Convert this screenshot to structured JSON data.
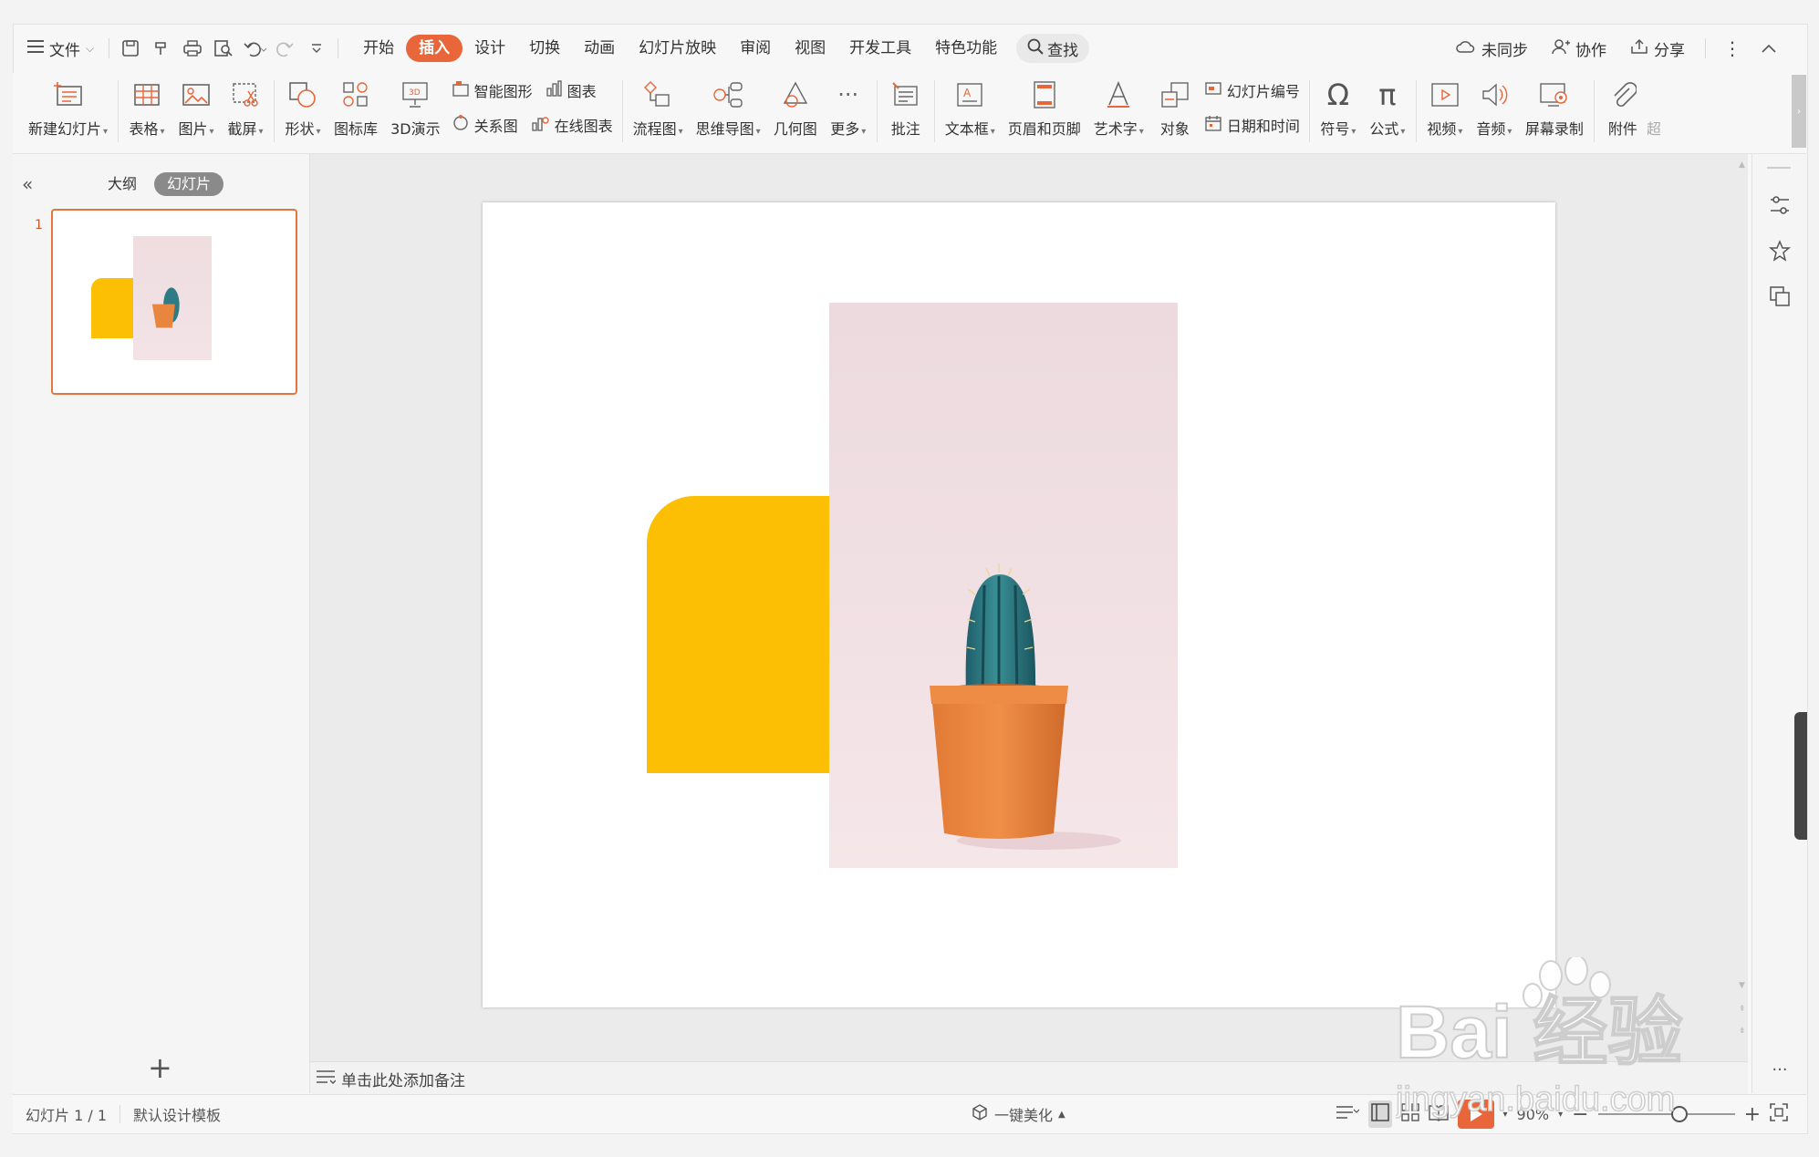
{
  "menubar": {
    "file_label": "文件",
    "tabs": [
      "开始",
      "插入",
      "设计",
      "切换",
      "动画",
      "幻灯片放映",
      "审阅",
      "视图",
      "开发工具",
      "特色功能"
    ],
    "active_tab": "插入",
    "search_label": "查找",
    "sync_label": "未同步",
    "collab_label": "协作",
    "share_label": "分享"
  },
  "ribbon": {
    "new_slide": "新建幻灯片",
    "table": "表格",
    "picture": "图片",
    "screenshot": "截屏",
    "shape": "形状",
    "icon_lib": "图标库",
    "demo3d": "3D演示",
    "smart_art": "智能图形",
    "chart": "图表",
    "relation": "关系图",
    "online_chart": "在线图表",
    "flowchart": "流程图",
    "mindmap": "思维导图",
    "geometry": "几何图",
    "more": "更多",
    "comment": "批注",
    "textbox": "文本框",
    "header_footer": "页眉和页脚",
    "wordart": "艺术字",
    "object": "对象",
    "slide_number": "幻灯片编号",
    "datetime": "日期和时间",
    "symbol": "符号",
    "formula": "公式",
    "video": "视频",
    "audio": "音频",
    "screen_record": "屏幕录制",
    "attachment": "附件",
    "hyperlink_partial": "超"
  },
  "leftpane": {
    "outline_tab": "大纲",
    "slides_tab": "幻灯片",
    "thumb_number": "1"
  },
  "notes": {
    "placeholder": "单击此处添加备注"
  },
  "statusbar": {
    "slide_info": "幻灯片 1 / 1",
    "template": "默认设计模板",
    "beautify": "一键美化",
    "zoom": "90%"
  },
  "watermark": {
    "brand": "Bai  经验",
    "url": "jingyan.baidu.com"
  },
  "colors": {
    "accent": "#e8663a",
    "yellow_shape": "#fdbf03",
    "pot": "#e8853f",
    "cactus": "#2f7b85"
  }
}
